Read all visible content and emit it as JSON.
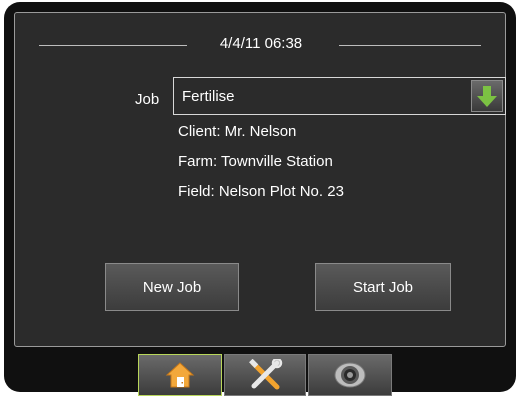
{
  "header": {
    "datetime": "4/4/11 06:38"
  },
  "job": {
    "label": "Job",
    "selected": "Fertilise",
    "dropdown_icon": "arrow-down-icon"
  },
  "details": {
    "client": "Client: Mr. Nelson",
    "farm": "Farm: Townville Station",
    "field": "Field: Nelson Plot No. 23"
  },
  "buttons": {
    "new_job": "New Job",
    "start_job": "Start Job"
  },
  "tabs": [
    {
      "name": "home",
      "icon": "home-icon",
      "active": true
    },
    {
      "name": "tools",
      "icon": "tools-icon",
      "active": false
    },
    {
      "name": "gps",
      "icon": "satellite-icon",
      "active": false
    }
  ],
  "colors": {
    "accent": "#7cc243",
    "active_tab_border": "#b8d65a",
    "background": "#2b2b2b"
  }
}
